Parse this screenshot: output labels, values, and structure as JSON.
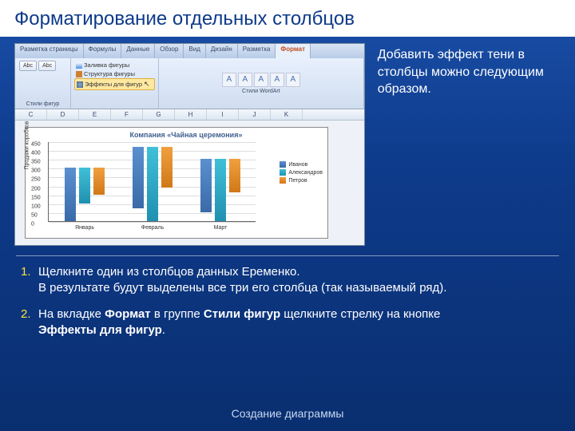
{
  "title": "Форматирование отдельных столбцов",
  "description": "Добавить эффект тени в столбцы можно следующим образом.",
  "ribbon": {
    "tabs": [
      "Разметка страницы",
      "Формулы",
      "Данные",
      "Обзор",
      "Вид",
      "Дизайн",
      "Разметка",
      "Формат"
    ],
    "active_tab_index": 7,
    "group_insert": {
      "btns": [
        "Abc",
        "Abc"
      ],
      "label": "Стили фигур"
    },
    "style_menu": {
      "item1": "Заливка фигуры",
      "item2": "Структура фигуры",
      "item3": "Эффекты для фигур"
    },
    "wordart_label": "Стили WordArt",
    "wa_glyph": "A"
  },
  "columns": [
    "C",
    "D",
    "E",
    "F",
    "G",
    "H",
    "I",
    "J",
    "K"
  ],
  "chart_data": {
    "type": "bar",
    "title": "Компания «Чайная церемония»",
    "ylabel": "Продажи коробков",
    "categories": [
      "Январь",
      "Февраль",
      "Март"
    ],
    "series": [
      {
        "name": "Иванов",
        "values": [
          300,
          350,
          300
        ]
      },
      {
        "name": "Александров",
        "values": [
          200,
          420,
          350
        ]
      },
      {
        "name": "Петров",
        "values": [
          150,
          230,
          190
        ]
      }
    ],
    "ylim": [
      0,
      450
    ],
    "yticks": [
      0,
      50,
      100,
      150,
      200,
      250,
      300,
      350,
      400,
      450
    ]
  },
  "steps": {
    "s1_num": "1.",
    "s1a": "Щелкните один из столбцов данных Еременко.",
    "s1b": "В результате будут выделены все три его столбца (так называемый ряд).",
    "s2_num": "2.",
    "s2a": "На вкладке ",
    "s2b_bold": "Формат",
    "s2c": " в группе ",
    "s2d_bold": "Стили фигур",
    "s2e": " щелкните стрелку на кнопке ",
    "s2f_bold": "Эффекты для фигур",
    "s2g": "."
  },
  "footer": "Создание диаграммы"
}
